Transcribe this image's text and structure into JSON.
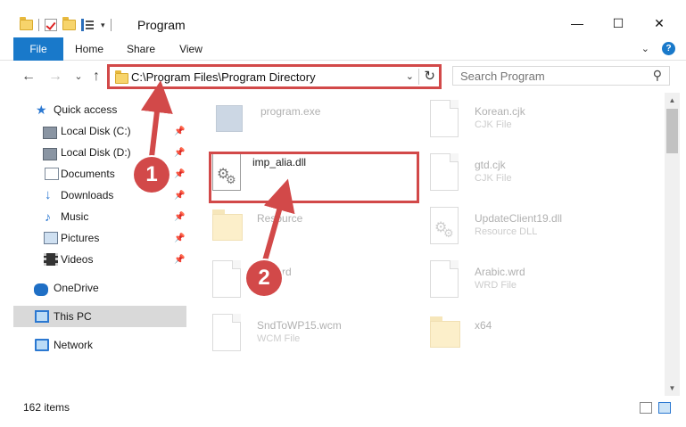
{
  "window": {
    "title": "Program",
    "minimize_glyph": "—",
    "maximize_glyph": "☐",
    "close_glyph": "✕"
  },
  "quick_access_toolbar": {
    "dropdown_glyph": "▾"
  },
  "ribbon": {
    "tabs": [
      "File",
      "Home",
      "Share",
      "View"
    ],
    "expand_glyph": "⌄",
    "help_glyph": "?"
  },
  "navigation": {
    "back_glyph": "←",
    "forward_glyph": "→",
    "recent_glyph": "⌄",
    "up_glyph": "↑"
  },
  "address_bar": {
    "path": "C:\\Program Files\\Program Directory",
    "dropdown_glyph": "⌄",
    "refresh_glyph": "↻"
  },
  "search": {
    "placeholder": "Search Program",
    "icon": "search-icon",
    "glyph": "⚲"
  },
  "nav_pane": {
    "items": [
      {
        "label": "Quick access",
        "icon": "star-icon",
        "pinned": false
      },
      {
        "label": "Local Disk (C:)",
        "icon": "drive-icon",
        "pinned": true
      },
      {
        "label": "Local Disk (D:)",
        "icon": "drive-icon",
        "pinned": true
      },
      {
        "label": "Documents",
        "icon": "documents-icon",
        "pinned": true
      },
      {
        "label": "Downloads",
        "icon": "downloads-icon",
        "pinned": true
      },
      {
        "label": "Music",
        "icon": "music-icon",
        "pinned": true
      },
      {
        "label": "Pictures",
        "icon": "pictures-icon",
        "pinned": true
      },
      {
        "label": "Videos",
        "icon": "videos-icon",
        "pinned": true
      },
      {
        "label": "OneDrive",
        "icon": "onedrive-icon",
        "pinned": false
      },
      {
        "label": "This PC",
        "icon": "this-pc-icon",
        "pinned": false,
        "selected": true
      },
      {
        "label": "Network",
        "icon": "network-icon",
        "pinned": false
      }
    ],
    "pin_glyph": "📌",
    "star_glyph": "★",
    "downloads_glyph": "↓",
    "music_glyph": "♪"
  },
  "files": [
    {
      "name": "program.exe",
      "type": "",
      "icon": "exe-icon",
      "faded": true
    },
    {
      "name": "Korean.cjk",
      "type": "CJK File",
      "icon": "file-icon",
      "faded": true
    },
    {
      "name": "imp_alia.dll",
      "type": "",
      "icon": "dll-gear-icon",
      "faded": false
    },
    {
      "name": "gtd.cjk",
      "type": "CJK File",
      "icon": "file-icon",
      "faded": true
    },
    {
      "name": "Resource",
      "type": "",
      "icon": "folder-icon",
      "faded": true
    },
    {
      "name": "UpdateClient19.dll",
      "type": "Resource DLL",
      "icon": "dll-gear-icon",
      "faded": true
    },
    {
      "name": "...c.wrd",
      "type": "...le",
      "icon": "file-icon",
      "faded": true
    },
    {
      "name": "Arabic.wrd",
      "type": "WRD File",
      "icon": "file-icon",
      "faded": true
    },
    {
      "name": "SndToWP15.wcm",
      "type": "WCM File",
      "icon": "file-icon",
      "faded": true
    },
    {
      "name": "x64",
      "type": "",
      "icon": "folder-icon",
      "faded": true
    }
  ],
  "gear_glyph": "⚙",
  "scrollbar": {
    "up_glyph": "▲",
    "down_glyph": "▼"
  },
  "status_bar": {
    "item_count": "162 items"
  },
  "annotations": {
    "callouts": [
      "1",
      "2"
    ],
    "color": "#d24949"
  },
  "colors": {
    "accent": "#1979ca",
    "highlight_red": "#d24949",
    "selected_nav": "#d9d9d9"
  }
}
